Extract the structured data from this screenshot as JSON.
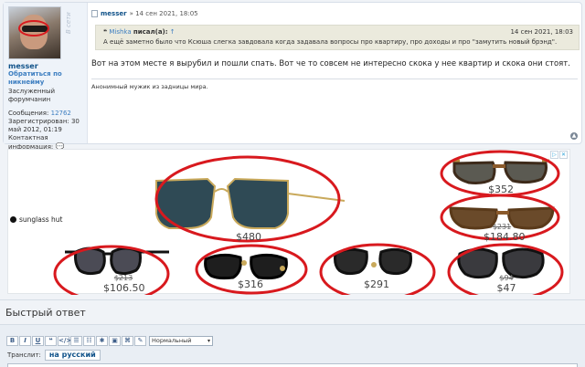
{
  "profile": {
    "online": "В сети",
    "name": "messer",
    "link": "Обратиться по никнейму",
    "rank": "Заслуженный форумчанин",
    "posts_label": "Сообщения:",
    "posts_value": "12762",
    "registered": "Зарегистрирован: 30 май 2012, 01:19",
    "contact": "Контактная информация:"
  },
  "post": {
    "author": "messer",
    "meta": "» 14 сен 2021, 18:05",
    "quote": {
      "author": "Mishka",
      "said": "писал(а):",
      "arrow": "↑",
      "date": "14 сен 2021, 18:03",
      "text": "А ещё заметно было что Ксюша слегка завдовала когда задавала вопросы про квартиру, про доходы и про \"замутить новый брэнд\"."
    },
    "text": "Вот на этом месте я вырубил и пошли спать. Вот че то совсем не интересно скока у нее квартир и скока они стоят.",
    "signature": "Анонимный мужик из задницы мира."
  },
  "ad": {
    "brand": "sunglass hut",
    "products": [
      {
        "price": "$480",
        "old": ""
      },
      {
        "price": "$352",
        "old": ""
      },
      {
        "price": "$184.80",
        "old": "$231"
      },
      {
        "price": "$106.50",
        "old": "$213"
      },
      {
        "price": "$316",
        "old": ""
      },
      {
        "price": "$291",
        "old": ""
      },
      {
        "price": "$47",
        "old": "$94"
      }
    ]
  },
  "quick_reply": {
    "title": "Быстрый ответ",
    "toolbar": [
      "B",
      "I",
      "U",
      "❝",
      "</>",
      "☰",
      "☷",
      "✱",
      "▣",
      "⌘",
      "✎"
    ],
    "font_size": "Нормальный",
    "translit_label": "Транслит:",
    "translit_button": "на русский"
  },
  "colors": {
    "link": "#105289",
    "annotation_red": "#d8191e",
    "quote_bg": "#ebeadd"
  }
}
